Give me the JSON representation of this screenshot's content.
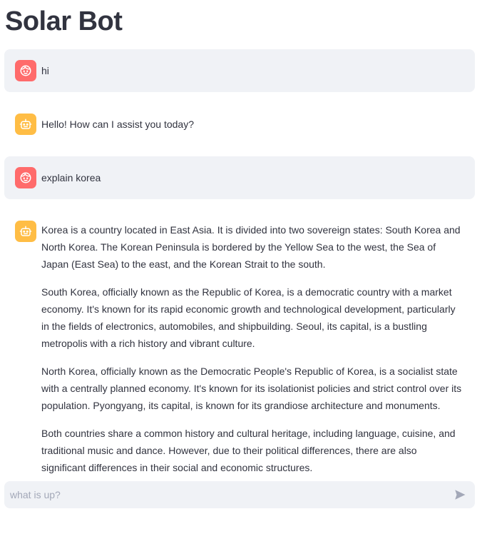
{
  "app": {
    "title": "Solar Bot"
  },
  "colors": {
    "user_avatar": "#ff6b6b",
    "assistant_avatar": "#ffbd45",
    "user_bubble": "#f0f2f6",
    "text": "#31333f",
    "placeholder": "#a3a8b8"
  },
  "messages": [
    {
      "role": "user",
      "avatar_icon": "face-icon",
      "paragraphs": [
        "hi"
      ]
    },
    {
      "role": "assistant",
      "avatar_icon": "robot-icon",
      "paragraphs": [
        "Hello! How can I assist you today?"
      ]
    },
    {
      "role": "user",
      "avatar_icon": "face-icon",
      "paragraphs": [
        "explain korea"
      ]
    },
    {
      "role": "assistant",
      "avatar_icon": "robot-icon",
      "paragraphs": [
        "Korea is a country located in East Asia. It is divided into two sovereign states: South Korea and North Korea. The Korean Peninsula is bordered by the Yellow Sea to the west, the Sea of Japan (East Sea) to the east, and the Korean Strait to the south.",
        "South Korea, officially known as the Republic of Korea, is a democratic country with a market economy. It's known for its rapid economic growth and technological development, particularly in the fields of electronics, automobiles, and shipbuilding. Seoul, its capital, is a bustling metropolis with a rich history and vibrant culture.",
        "North Korea, officially known as the Democratic People's Republic of Korea, is a socialist state with a centrally planned economy. It's known for its isolationist policies and strict control over its population. Pyongyang, its capital, is known for its grandiose architecture and monuments.",
        "Both countries share a common history and cultural heritage, including language, cuisine, and traditional music and dance. However, due to their political differences, there are also significant differences in their social and economic structures."
      ]
    }
  ],
  "chat_input": {
    "placeholder": "what is up?",
    "value": "",
    "send_icon": "send-icon"
  }
}
